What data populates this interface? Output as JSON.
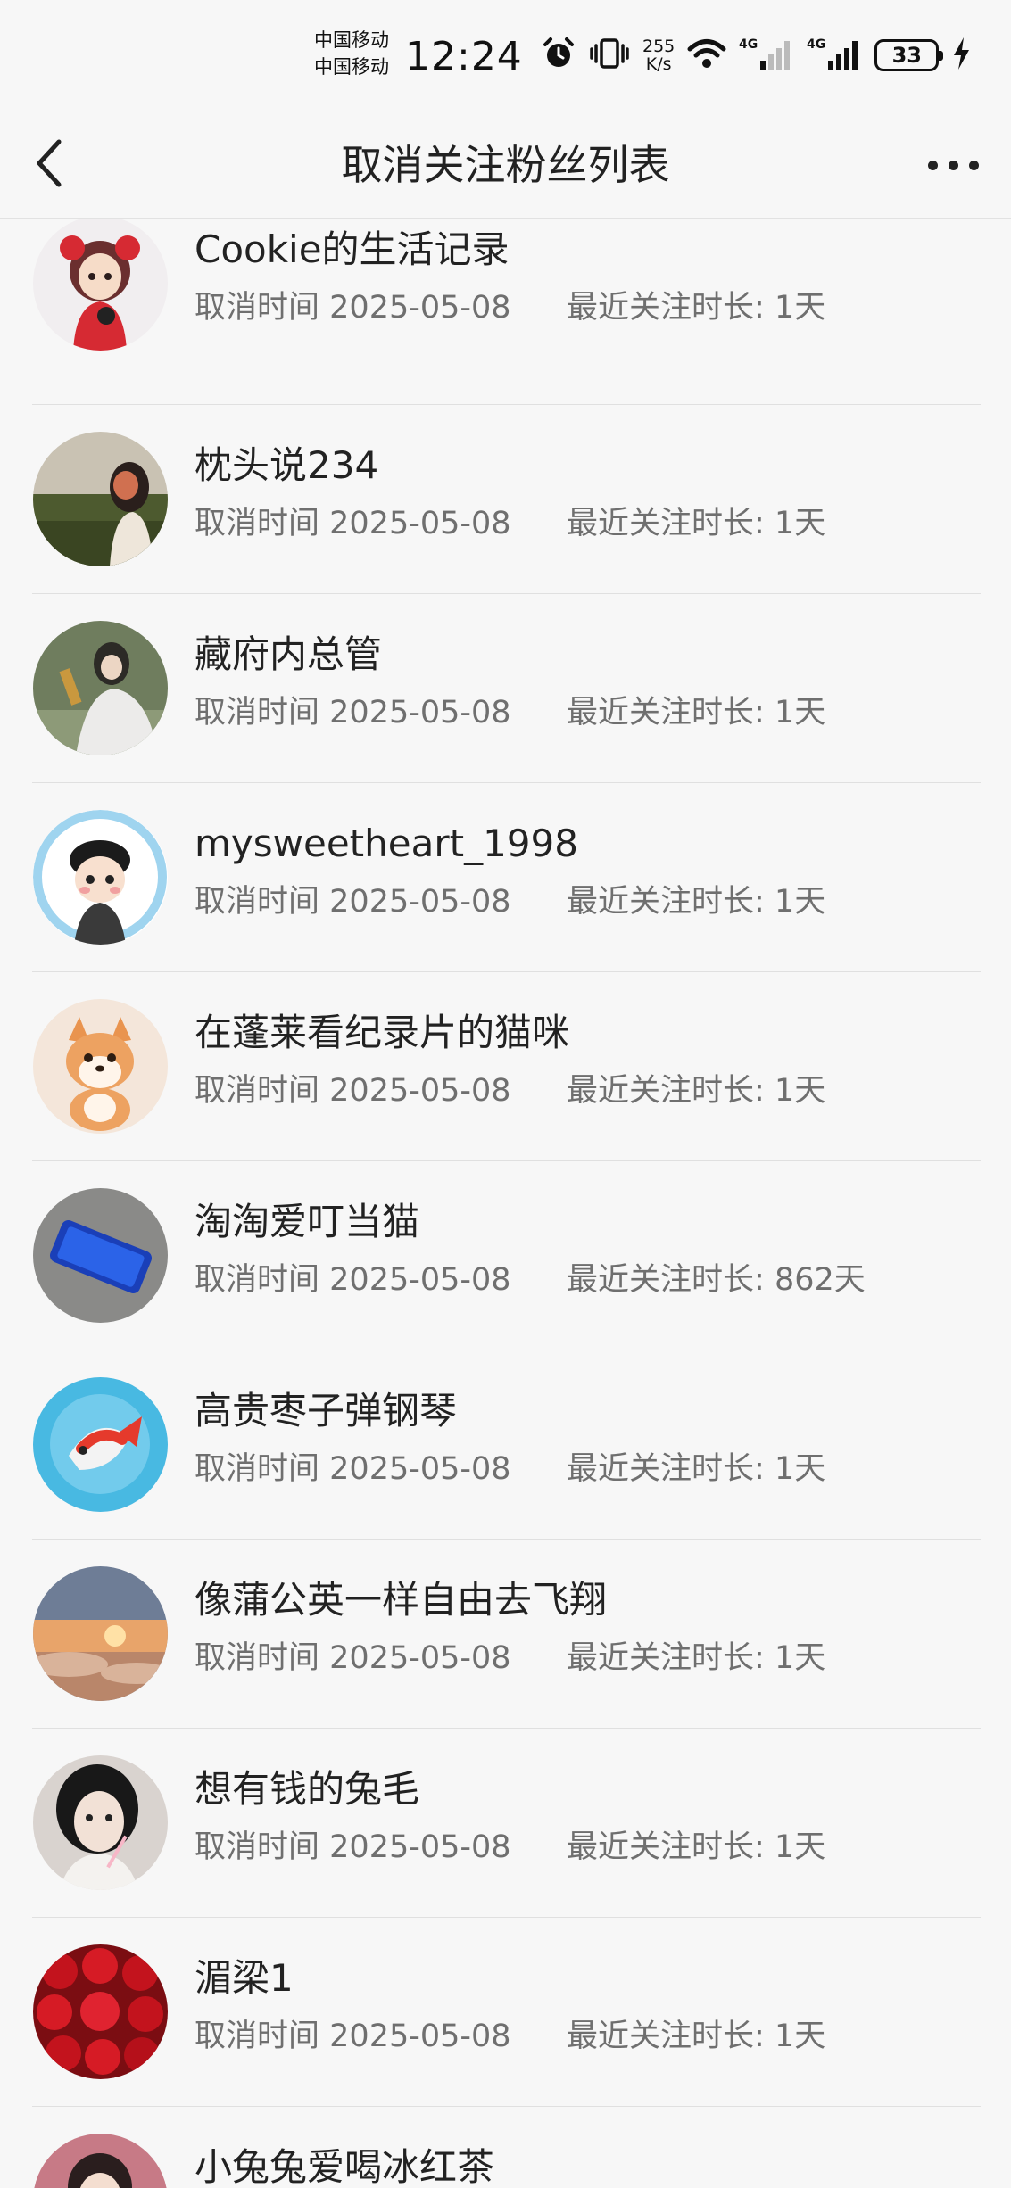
{
  "status_bar": {
    "carrier_1": "中国移动",
    "carrier_2": "中国移动",
    "time": "12:24",
    "speed_value": "255",
    "speed_unit": "K/s",
    "network_1": "4G",
    "network_2": "4G",
    "battery": "33",
    "icons": [
      "alarm-icon",
      "vibrate-icon",
      "wifi-icon",
      "signal-icon",
      "battery-icon",
      "charging-icon"
    ]
  },
  "nav": {
    "title": "取消关注粉丝列表",
    "back_icon": "chevron-left-icon",
    "more_icon": "more-dots-icon"
  },
  "list": {
    "cancel_label": "取消时间",
    "duration_label": "最近关注时长:",
    "items": [
      {
        "name": "Cookie的生活记录",
        "cancel_date": "2025-05-08",
        "duration": "1天"
      },
      {
        "name": "枕头说234",
        "cancel_date": "2025-05-08",
        "duration": "1天"
      },
      {
        "name": "藏府内总管",
        "cancel_date": "2025-05-08",
        "duration": "1天"
      },
      {
        "name": "mysweetheart_1998",
        "cancel_date": "2025-05-08",
        "duration": "1天"
      },
      {
        "name": "在蓬莱看纪录片的猫咪",
        "cancel_date": "2025-05-08",
        "duration": "1天"
      },
      {
        "name": "淘淘爱叮当猫",
        "cancel_date": "2025-05-08",
        "duration": "862天"
      },
      {
        "name": "高贵枣子弹钢琴",
        "cancel_date": "2025-05-08",
        "duration": "1天"
      },
      {
        "name": "像蒲公英一样自由去飞翔",
        "cancel_date": "2025-05-08",
        "duration": "1天"
      },
      {
        "name": "想有钱的兔毛",
        "cancel_date": "2025-05-08",
        "duration": "1天"
      },
      {
        "name": "湄梁1",
        "cancel_date": "2025-05-08",
        "duration": "1天"
      },
      {
        "name": "小兔兔爱喝冰红茶",
        "cancel_date": "",
        "duration": ""
      }
    ]
  }
}
